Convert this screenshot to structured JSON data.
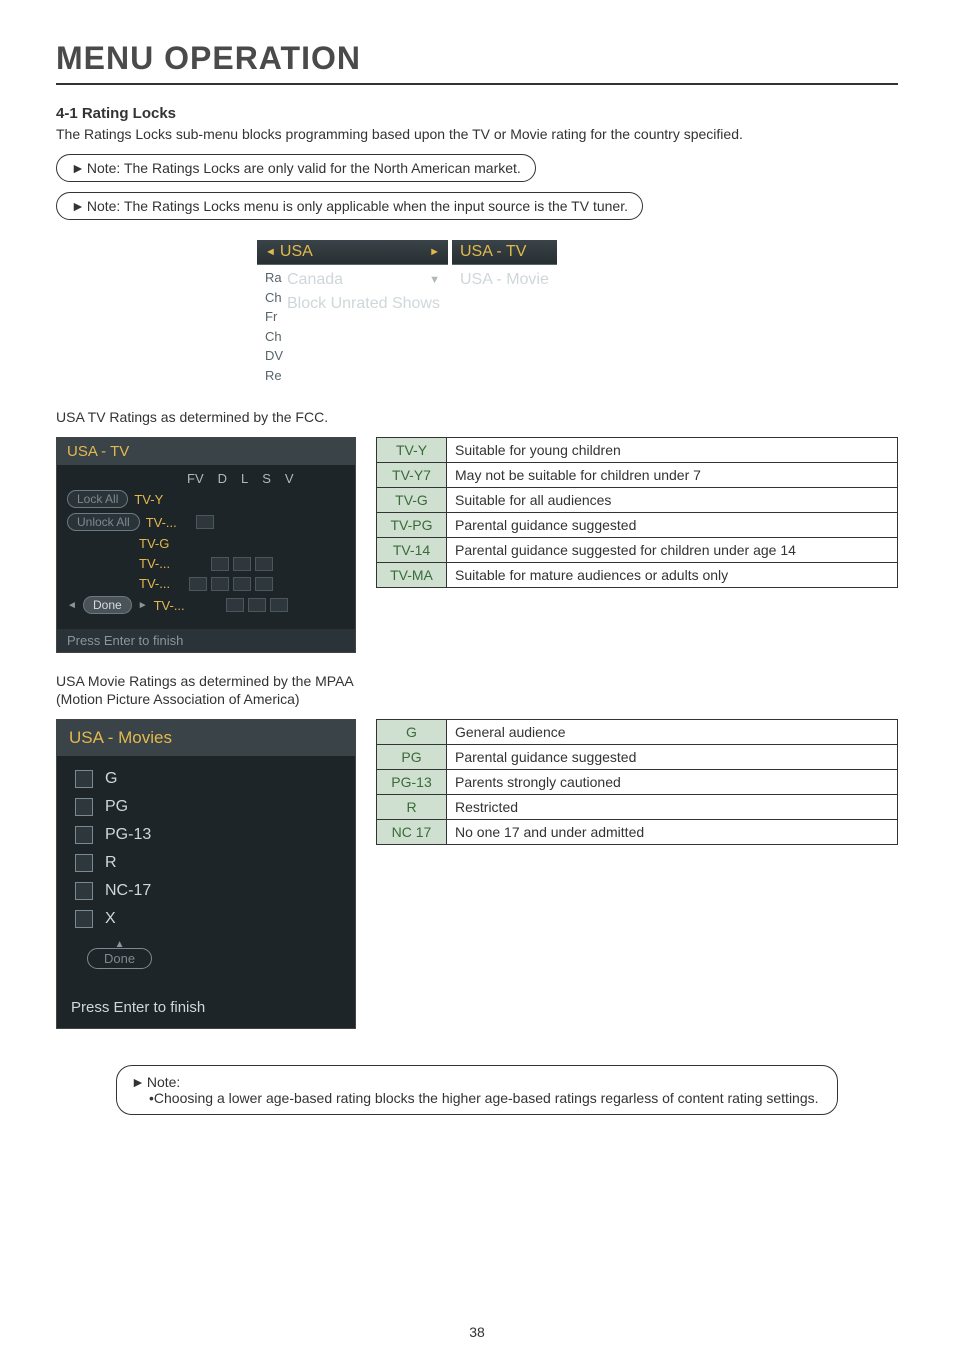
{
  "page_title": "MENU OPERATION",
  "section": {
    "num_title": "4-1  Rating Locks",
    "intro": "The Ratings Locks sub-menu blocks programming based upon the TV or Movie rating for the country specified."
  },
  "note1": "Note: The Ratings Locks are only valid for the North American market.",
  "note2": "Note: The Ratings Locks menu is only applicable when the input source is the TV tuner.",
  "top_panel": {
    "left_header": "USA",
    "left_items": [
      "Canada",
      "Block Unrated Shows"
    ],
    "left_side_letters": [
      "Ra",
      "Ch",
      "Fr",
      "Ch",
      "DV",
      "Re"
    ],
    "right_header": "USA - TV",
    "right_items": [
      "USA - Movie"
    ]
  },
  "usa_tv_caption": "USA TV Ratings as determined by the FCC.",
  "usa_tv_panel": {
    "title": "USA - TV",
    "cols": [
      "FV",
      "D",
      "L",
      "S",
      "V"
    ],
    "lock_all": "Lock All",
    "unlock_all": "Unlock All",
    "rows": [
      {
        "label": "TV-Y",
        "boxes": 0
      },
      {
        "label": "TV-...",
        "boxes": 1
      },
      {
        "label": "TV-G",
        "boxes": 0
      },
      {
        "label": "TV-...",
        "boxes": 3
      },
      {
        "label": "TV-...",
        "boxes": 4
      },
      {
        "label": "TV-...",
        "boxes": 3,
        "prefix_arrow": true
      }
    ],
    "done": "Done",
    "footer": "Press Enter to finish"
  },
  "usa_tv_table": [
    {
      "code": "TV-Y",
      "desc": "Suitable for young children"
    },
    {
      "code": "TV-Y7",
      "desc": "May not be suitable for children under 7"
    },
    {
      "code": "TV-G",
      "desc": "Suitable for all audiences"
    },
    {
      "code": "TV-PG",
      "desc": "Parental guidance suggested"
    },
    {
      "code": "TV-14",
      "desc": "Parental guidance suggested for children under age 14"
    },
    {
      "code": "TV-MA",
      "desc": "Suitable for mature audiences or adults only"
    }
  ],
  "usa_movie_caption_l1": "USA Movie Ratings as determined by the MPAA",
  "usa_movie_caption_l2": "(Motion Picture Association of America)",
  "movies_panel": {
    "title": "USA - Movies",
    "items": [
      "G",
      "PG",
      "PG-13",
      "R",
      "NC-17",
      "X"
    ],
    "done": "Done",
    "footer": "Press Enter to finish"
  },
  "movies_table": [
    {
      "code": "G",
      "desc": "General audience"
    },
    {
      "code": "PG",
      "desc": "Parental guidance suggested"
    },
    {
      "code": "PG-13",
      "desc": "Parents strongly cautioned"
    },
    {
      "code": "R",
      "desc": "Restricted"
    },
    {
      "code": "NC 17",
      "desc": "No one 17 and under admitted"
    }
  ],
  "bottom_note": {
    "label": "Note:",
    "bullet": "•Choosing a lower age-based rating blocks the higher age-based ratings regarless of content rating settings."
  },
  "page_number": "38"
}
